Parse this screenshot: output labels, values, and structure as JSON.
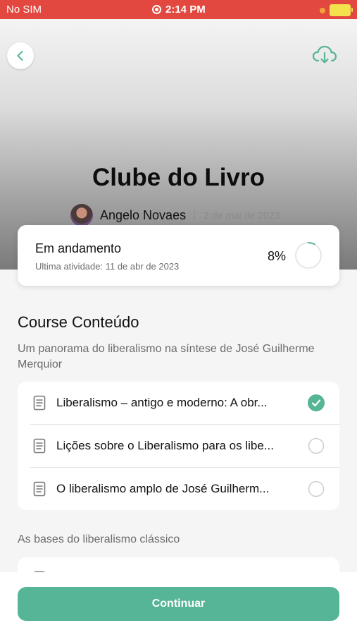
{
  "status_bar": {
    "carrier": "No SIM",
    "time": "2:14 PM"
  },
  "course": {
    "title": "Clube do Livro",
    "author": "Angelo Novaes",
    "date": "2 de mai de 2023"
  },
  "progress": {
    "status": "Em andamento",
    "last_activity": "Ultima atividade:  11 de abr de 2023",
    "percent_text": "8%",
    "percent_value": 8
  },
  "content": {
    "title": "Course Conteúdo",
    "sections": [
      {
        "title": "Um panorama do liberalismo na síntese de José Guilherme Merquior",
        "lessons": [
          {
            "label": "Liberalismo – antigo e moderno: A obr...",
            "completed": true
          },
          {
            "label": "Lições sobre o Liberalismo para os libe...",
            "completed": false
          },
          {
            "label": "O liberalismo amplo de José Guilherm...",
            "completed": false
          }
        ]
      },
      {
        "title": "As bases do liberalismo clássico"
      }
    ]
  },
  "continue_label": "Continuar",
  "colors": {
    "accent": "#55b596",
    "status_bar": "#e2483f",
    "check_done": "#55b596"
  }
}
